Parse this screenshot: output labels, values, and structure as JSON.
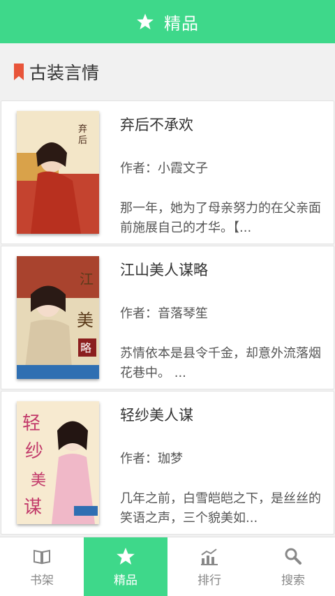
{
  "header": {
    "title": "精品",
    "icon": "star-icon",
    "color": "#3ed88a"
  },
  "section": {
    "title": "古装言情",
    "icon": "bookmark-icon",
    "icon_color": "#e8553a"
  },
  "books": [
    {
      "title": "弃后不承欢",
      "author": "作者：小霞文子",
      "desc": "那一年，她为了母亲努力的在父亲面前施展自己的才华。【..."
    },
    {
      "title": "江山美人谋略",
      "author": "作者：音落琴笙",
      "desc": "苏情依本是县令千金，却意外流落烟花巷中。 ..."
    },
    {
      "title": "轻纱美人谋",
      "author": "作者：珈梦",
      "desc": " 几年之前，白雪皑皑之下，是丝丝的笑语之声，三个貌美如..."
    }
  ],
  "tabs": [
    {
      "label": "书架",
      "icon": "book-icon",
      "active": false
    },
    {
      "label": "精品",
      "icon": "star-icon",
      "active": true
    },
    {
      "label": "排行",
      "icon": "chart-icon",
      "active": false
    },
    {
      "label": "搜索",
      "icon": "search-icon",
      "active": false
    }
  ]
}
